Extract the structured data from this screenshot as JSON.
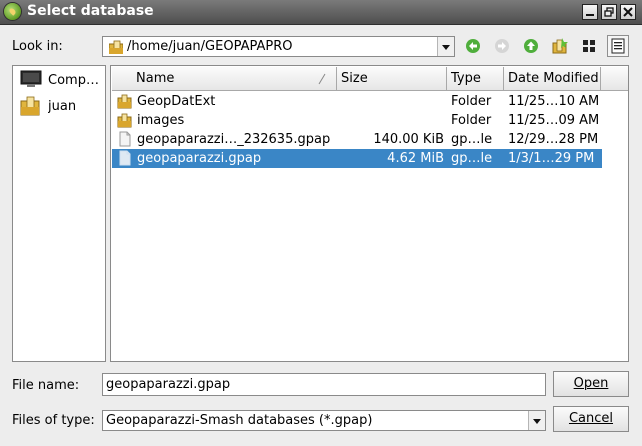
{
  "window": {
    "title": "Select database"
  },
  "toolbar": {
    "look_in_label": "Look in:",
    "path": "/home/juan/GEOPAPAPRO"
  },
  "sidebar": {
    "items": [
      {
        "label": "Comp…",
        "icon": "computer-icon"
      },
      {
        "label": "juan",
        "icon": "folder-icon"
      }
    ]
  },
  "columns": {
    "name": "Name",
    "size": "Size",
    "type": "Type",
    "date": "Date Modified"
  },
  "files": [
    {
      "name": "GeopDatExt",
      "size": "",
      "type": "Folder",
      "date": "11/25…10 AM",
      "icon": "folder-icon",
      "selected": false
    },
    {
      "name": "images",
      "size": "",
      "type": "Folder",
      "date": "11/25…09 AM",
      "icon": "folder-icon",
      "selected": false
    },
    {
      "name": "geopaparazzi…_232635.gpap",
      "size": "140.00 KiB",
      "type": "gp…le",
      "date": "12/29…28 PM",
      "icon": "file-icon",
      "selected": false
    },
    {
      "name": "geopaparazzi.gpap",
      "size": "4.62 MiB",
      "type": "gp…le",
      "date": "1/3/1…29 PM",
      "icon": "file-icon",
      "selected": true
    }
  ],
  "footer": {
    "file_name_label": "File name:",
    "file_name_value": "geopaparazzi.gpap",
    "file_type_label": "Files of type:",
    "file_type_value": "Geopaparazzi-Smash databases (*.gpap)",
    "open_label": "Open",
    "cancel_label": "Cancel"
  },
  "colors": {
    "selection": "#3a86c6",
    "titlebar": "#5a5a5a",
    "nav_green": "#4fae3c"
  }
}
